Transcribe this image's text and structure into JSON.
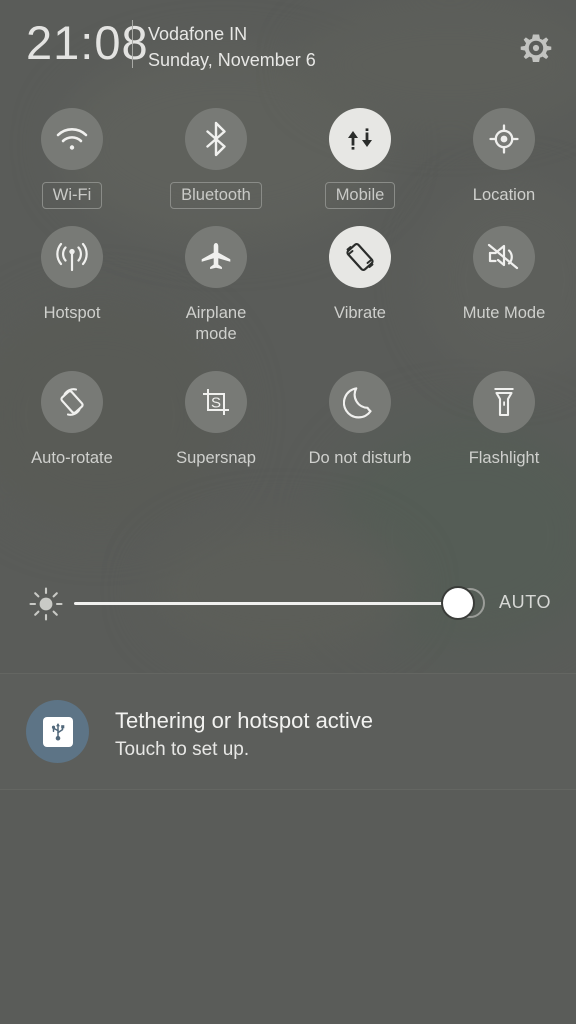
{
  "statusbar": {
    "time": "21:08",
    "carrier": "Vodafone IN",
    "date": "Sunday, November 6",
    "settings_icon": "gear-icon"
  },
  "quick_settings": {
    "tiles": [
      {
        "id": "wifi",
        "label": "Wi-Fi",
        "icon": "wifi-icon",
        "active": false,
        "has_pill": true
      },
      {
        "id": "bluetooth",
        "label": "Bluetooth",
        "icon": "bluetooth-icon",
        "active": false,
        "has_pill": true
      },
      {
        "id": "mobile",
        "label": "Mobile",
        "icon": "mobile-data-icon",
        "active": true,
        "has_pill": true
      },
      {
        "id": "location",
        "label": "Location",
        "icon": "location-icon",
        "active": false,
        "has_pill": false
      },
      {
        "id": "hotspot",
        "label": "Hotspot",
        "icon": "hotspot-icon",
        "active": false,
        "has_pill": false
      },
      {
        "id": "airplane",
        "label": "Airplane\nmode",
        "icon": "airplane-icon",
        "active": false,
        "has_pill": false
      },
      {
        "id": "vibrate",
        "label": "Vibrate",
        "icon": "vibrate-icon",
        "active": true,
        "has_pill": false
      },
      {
        "id": "mute",
        "label": "Mute Mode",
        "icon": "mute-icon",
        "active": false,
        "has_pill": false
      },
      {
        "id": "autorotate",
        "label": "Auto-rotate",
        "icon": "auto-rotate-icon",
        "active": false,
        "has_pill": false
      },
      {
        "id": "supersnap",
        "label": "Supersnap",
        "icon": "supersnap-icon",
        "active": false,
        "has_pill": false
      },
      {
        "id": "dnd",
        "label": "Do not disturb",
        "icon": "moon-icon",
        "active": false,
        "has_pill": false
      },
      {
        "id": "flashlight",
        "label": "Flashlight",
        "icon": "flashlight-icon",
        "active": false,
        "has_pill": false
      }
    ]
  },
  "brightness": {
    "icon": "brightness-sun-icon",
    "auto_label": "AUTO",
    "value_percent": 96
  },
  "notification": {
    "icon": "usb-icon",
    "title": "Tethering or hotspot active",
    "text": "Touch to set up.",
    "icon_color": "#5d7486"
  },
  "colors": {
    "shade_background": "#5a5c59",
    "tile_inactive": "#787a76",
    "tile_active": "#e7e7e4",
    "text_primary": "#f2f2f0",
    "text_secondary": "#cfd0cd"
  }
}
